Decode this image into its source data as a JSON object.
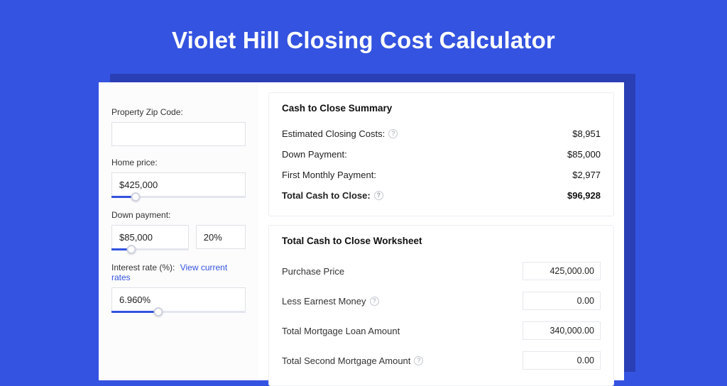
{
  "title": "Violet Hill Closing Cost Calculator",
  "left": {
    "zip_label": "Property Zip Code:",
    "zip_value": "",
    "home_price_label": "Home price:",
    "home_price_value": "$425,000",
    "down_payment_label": "Down payment:",
    "down_payment_value": "$85,000",
    "down_payment_pct": "20%",
    "interest_label": "Interest rate (%):",
    "interest_link": "View current rates",
    "interest_value": "6.960%"
  },
  "summary": {
    "heading": "Cash to Close Summary",
    "rows": [
      {
        "label": "Estimated Closing Costs:",
        "value": "$8,951",
        "help": true
      },
      {
        "label": "Down Payment:",
        "value": "$85,000",
        "help": false
      },
      {
        "label": "First Monthly Payment:",
        "value": "$2,977",
        "help": false
      }
    ],
    "total_label": "Total Cash to Close:",
    "total_value": "$96,928"
  },
  "worksheet": {
    "heading": "Total Cash to Close Worksheet",
    "rows": [
      {
        "label": "Purchase Price",
        "value": "425,000.00",
        "help": false
      },
      {
        "label": "Less Earnest Money",
        "value": "0.00",
        "help": true
      },
      {
        "label": "Total Mortgage Loan Amount",
        "value": "340,000.00",
        "help": false
      },
      {
        "label": "Total Second Mortgage Amount",
        "value": "0.00",
        "help": true
      }
    ]
  }
}
